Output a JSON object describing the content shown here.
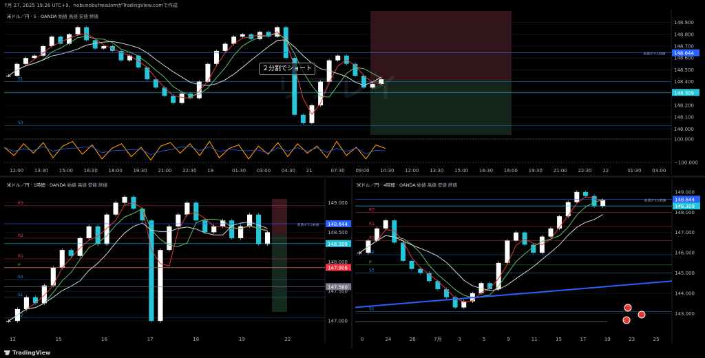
{
  "header": {
    "timestamp_line": "7月 27, 2025 19:26 UTC+9、nobunobufreedomがTradingView.comで作成"
  },
  "brand": {
    "logo_text": "TradingView"
  },
  "annotation": {
    "text": "２分割でショート"
  },
  "watermark": {
    "text": "リプレイ"
  },
  "colors": {
    "background": "#000000",
    "axis_text": "#b2b5be",
    "price_blue": "#2962ff",
    "price_cyan": "#26c6da",
    "price_red": "#f23645",
    "price_gray": "#787b86",
    "ma_red": "#e53935",
    "ma_green": "#66bb6a",
    "ma_white": "#cfd8dc",
    "oscillator_orange": "#ff9800",
    "trendline_blue": "#2962ff",
    "pivot_red": "#f23645",
    "pivot_green": "#4caf50",
    "pivot_blue": "#2196f3"
  },
  "chart_data": [
    {
      "id": "m5",
      "type": "candlestick",
      "title": "米ドル／円 · 5 · OANDA",
      "ohlc_labels": [
        "始値",
        "高値",
        "安値",
        "終値"
      ],
      "ylim": [
        147.95,
        148.95
      ],
      "yticks": [
        148.9,
        148.8,
        148.7,
        148.6,
        148.5,
        148.4,
        148.3,
        148.2,
        148.1,
        148.0
      ],
      "ytick_labels": [
        "148.900",
        "148.800",
        "148.700",
        "148.600",
        "148.500",
        "148.400",
        "148.300",
        "148.200",
        "148.100",
        "148.000"
      ],
      "xticks": [
        "12:00",
        "13:30",
        "15:00",
        "16:30",
        "18:00",
        "19:30",
        "21:00",
        "22:30",
        "19",
        "01:30",
        "03:00",
        "04:30",
        "21",
        "07:30",
        "09:00",
        "10:30",
        "12:00",
        "13:30",
        "15:00",
        "16:30",
        "18:00",
        "19:30",
        "21:00",
        "22:30",
        "22",
        "01:30",
        "03:00"
      ],
      "price_labels": [
        {
          "value": 148.644,
          "text": "148.644",
          "color": "#2962ff"
        },
        {
          "value": 148.309,
          "text": "148.309",
          "color": "#26c6da"
        }
      ],
      "series_close": [
        148.45,
        148.55,
        148.6,
        148.62,
        148.7,
        148.78,
        148.72,
        148.8,
        148.86,
        148.75,
        148.68,
        148.7,
        148.66,
        148.58,
        148.62,
        148.52,
        148.42,
        148.35,
        148.28,
        148.22,
        148.3,
        148.26,
        148.4,
        148.55,
        148.66,
        148.72,
        148.78,
        148.8,
        148.76,
        148.82,
        148.78,
        148.86,
        148.6,
        148.12,
        148.05,
        148.2,
        148.4,
        148.58,
        148.62,
        148.55,
        148.45,
        148.35,
        148.38,
        148.42
      ],
      "oscillator": {
        "ylim": [
          -100,
          100
        ],
        "yticks": [
          100,
          -100
        ],
        "ytick_labels": [
          "100.000",
          "−100.000"
        ],
        "values": [
          30,
          -40,
          60,
          -20,
          70,
          -60,
          40,
          80,
          -30,
          50,
          -70,
          20,
          60,
          -50,
          30,
          -80,
          40,
          70,
          -20,
          60,
          -40,
          80,
          -60,
          20,
          50,
          -70,
          40,
          -30,
          70,
          -50,
          60,
          -20,
          40,
          -60,
          80,
          -40,
          30,
          -70,
          50,
          20
        ]
      },
      "levels": [
        {
          "label": "S3",
          "value": 148.03
        },
        {
          "label": "S1",
          "value": 148.4
        }
      ],
      "right_note": "前週ダラス終値"
    },
    {
      "id": "h1",
      "type": "candlestick",
      "title": "米ドル／円 · 1時間 · OANDA",
      "ohlc_labels": [
        "始値",
        "高値",
        "安値",
        "終値"
      ],
      "ylim": [
        146.85,
        149.25
      ],
      "yticks": [
        149.0,
        148.5,
        148.0,
        147.5,
        147.0
      ],
      "ytick_labels": [
        "149.000",
        "148.500",
        "148.000",
        "147.500",
        "147.000"
      ],
      "xticks": [
        "12",
        "15",
        "16",
        "17",
        "18",
        "19",
        "22"
      ],
      "price_labels": [
        {
          "value": 148.644,
          "text": "148.644",
          "color": "#2962ff"
        },
        {
          "value": 148.309,
          "text": "148.309",
          "color": "#26c6da"
        },
        {
          "value": 147.906,
          "text": "147.906",
          "color": "#f23645"
        },
        {
          "value": 147.58,
          "text": "147.580",
          "color": "#787b86"
        }
      ],
      "series_close": [
        147.0,
        147.2,
        147.4,
        147.3,
        147.6,
        147.9,
        148.2,
        148.1,
        148.4,
        148.6,
        148.3,
        148.8,
        149.0,
        149.1,
        148.9,
        148.7,
        147.0,
        148.2,
        148.6,
        148.8,
        149.0,
        148.7,
        148.5,
        148.6,
        148.7,
        148.4,
        148.6,
        148.8,
        148.3,
        148.5
      ],
      "levels": [
        {
          "label": "R3",
          "value": 148.95
        },
        {
          "label": "R2",
          "value": 148.4
        },
        {
          "label": "R1",
          "value": 148.05
        },
        {
          "label": "P",
          "value": 147.9
        },
        {
          "label": "S1",
          "value": 147.4
        },
        {
          "label": "S2",
          "value": 147.05
        },
        {
          "label": "S3",
          "value": 147.7
        }
      ],
      "right_note": "前週ダラス終値"
    },
    {
      "id": "h4",
      "type": "candlestick",
      "title": "米ドル／円 · 4時間 · OANDA",
      "ohlc_labels": [
        "始値",
        "高値",
        "安値",
        "終値"
      ],
      "ylim": [
        142.4,
        149.2
      ],
      "yticks": [
        149.0,
        148.0,
        147.0,
        146.0,
        145.0,
        144.0,
        143.0
      ],
      "ytick_labels": [
        "149.000",
        "148.000",
        "147.000",
        "146.000",
        "145.000",
        "144.000",
        "143.000"
      ],
      "xticks": [
        "0",
        "24",
        "26",
        "7月",
        "3",
        "5",
        "9",
        "11",
        "15",
        "17",
        "19",
        "23",
        "25"
      ],
      "price_labels": [
        {
          "value": 148.644,
          "text": "148.644",
          "color": "#2962ff"
        },
        {
          "value": 148.309,
          "text": "148.309",
          "color": "#26c6da"
        }
      ],
      "series_close": [
        146.0,
        146.6,
        147.2,
        147.6,
        146.5,
        145.6,
        145.2,
        145.0,
        144.6,
        144.2,
        143.8,
        143.3,
        143.6,
        144.0,
        144.5,
        144.2,
        145.5,
        146.6,
        147.0,
        146.4,
        146.0,
        146.8,
        147.2,
        147.8,
        148.5,
        149.0,
        148.8,
        148.3,
        148.6
      ],
      "levels": [
        {
          "label": "R3",
          "value": 148.0
        },
        {
          "label": "R2",
          "value": 146.6
        },
        {
          "label": "R1",
          "value": 147.3
        },
        {
          "label": "P",
          "value": 145.4
        },
        {
          "label": "S1",
          "value": 143.1
        },
        {
          "label": "S2",
          "value": 145.9
        },
        {
          "label": "S3",
          "value": 145.0
        }
      ],
      "right_note": "前週ダラス終値"
    }
  ]
}
